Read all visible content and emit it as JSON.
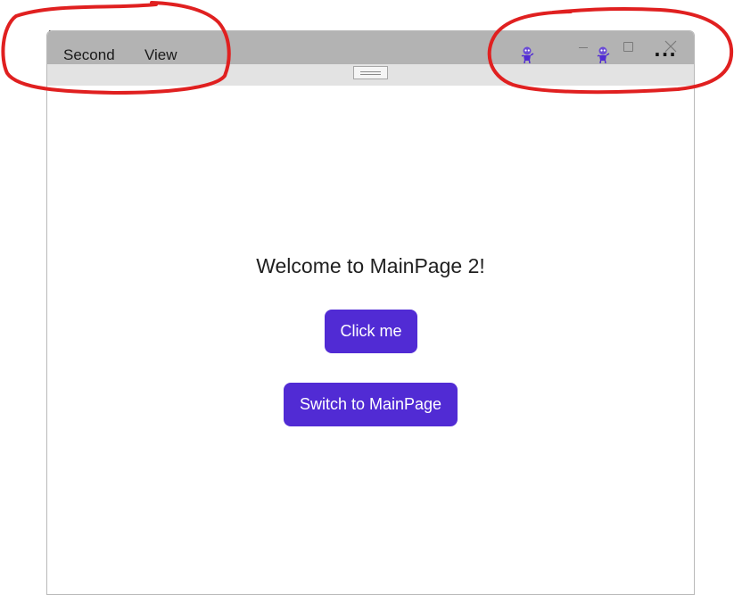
{
  "menu": {
    "items": [
      {
        "label": "Second"
      },
      {
        "label": "View"
      }
    ]
  },
  "titlebar": {
    "icons": [
      "app-icon",
      "app-icon"
    ],
    "controls": [
      "minimize-icon",
      "maximize-icon",
      "close-icon"
    ],
    "more_label": "..."
  },
  "content": {
    "heading": "Welcome to MainPage 2!",
    "buttons": {
      "click_label": "Click me",
      "switch_label": "Switch to MainPage"
    }
  },
  "colors": {
    "accent": "#512bd4",
    "titlebar": "#b3b3b3",
    "subbar": "#e3e3e3",
    "annotation": "#e02020"
  }
}
